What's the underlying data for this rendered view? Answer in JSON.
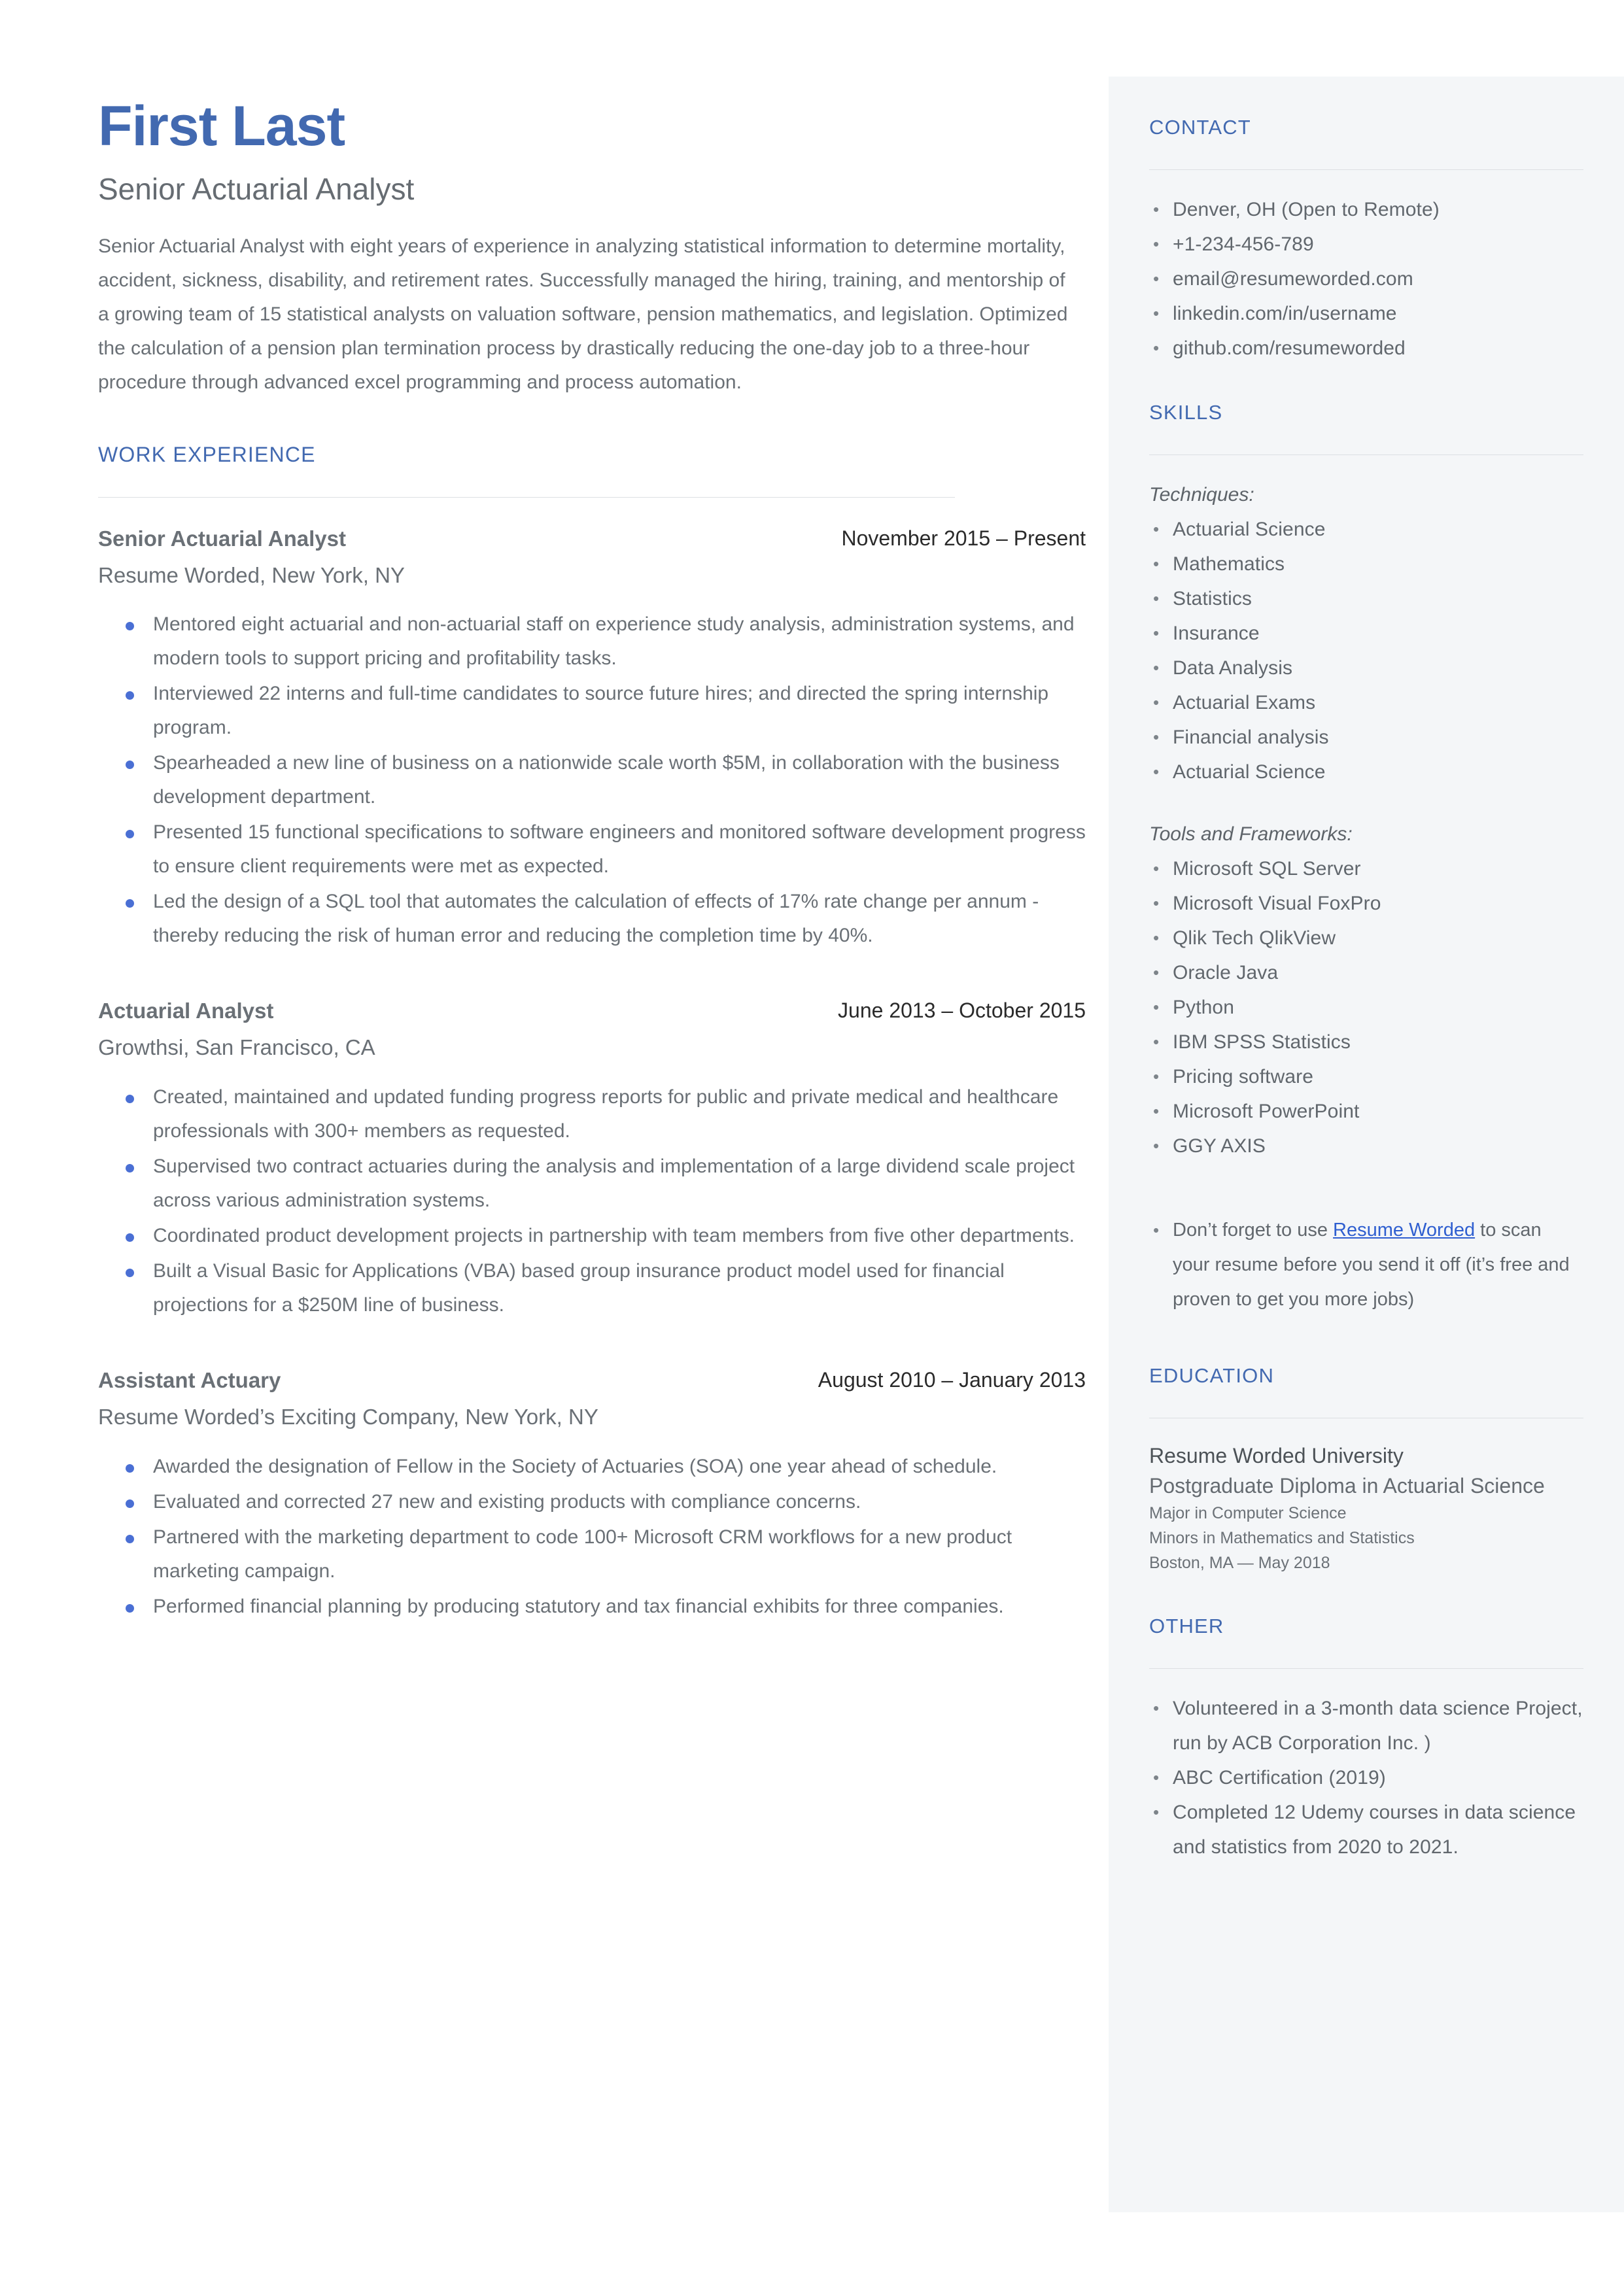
{
  "accent_color": "#4269b0",
  "bullet_color": "#4a6fd4",
  "sidebar_bg": "#f4f6f8",
  "header": {
    "name": "First Last",
    "role": "Senior Actuarial Analyst",
    "summary": "Senior Actuarial Analyst with eight years of experience in analyzing statistical information to determine mortality, accident, sickness, disability, and retirement rates. Successfully managed the hiring, training, and mentorship of a growing team of 15 statistical analysts on valuation software, pension mathematics, and legislation. Optimized the calculation of a pension plan termination process by drastically reducing the one-day job to a three-hour procedure through advanced excel programming and process automation."
  },
  "work": {
    "heading": "WORK EXPERIENCE",
    "jobs": [
      {
        "title": "Senior Actuarial Analyst",
        "dates": "November 2015 – Present",
        "company": "Resume Worded, New York, NY",
        "bullets": [
          "Mentored eight actuarial and non-actuarial staff on experience study analysis, administration systems, and modern tools to support pricing and profitability tasks.",
          "Interviewed 22 interns and full-time candidates to source future hires; and directed the spring internship program.",
          "Spearheaded a new line of business on a nationwide scale worth $5M, in collaboration with the business development department.",
          "Presented 15 functional specifications to software engineers and monitored software development progress to ensure client requirements were met as expected.",
          "Led the design of a SQL tool that automates the calculation of effects of 17% rate change per annum - thereby reducing the risk of human error and reducing the completion time by 40%."
        ]
      },
      {
        "title": "Actuarial Analyst",
        "dates": "June 2013 – October 2015",
        "company": "Growthsi, San Francisco, CA",
        "bullets": [
          "Created, maintained and updated funding progress reports for public and private medical and healthcare professionals with 300+ members as requested.",
          "Supervised two contract actuaries during the analysis and implementation of a large dividend scale project across various administration systems.",
          "Coordinated product development projects in partnership with team members from five other departments.",
          "Built a Visual Basic for Applications (VBA) based group insurance product model used for financial projections for a $250M line of business."
        ]
      },
      {
        "title": "Assistant Actuary",
        "dates": "August 2010 – January 2013",
        "company": "Resume Worded’s Exciting Company, New York, NY",
        "bullets": [
          "Awarded the designation of Fellow in the Society of Actuaries (SOA) one year ahead of schedule.",
          "Evaluated and corrected 27 new and existing products with compliance concerns.",
          "Partnered with the marketing department to code 100+ Microsoft CRM workflows for a new product marketing campaign.",
          "Performed financial planning by producing statutory and tax financial exhibits for three companies."
        ]
      }
    ]
  },
  "contact": {
    "heading": "CONTACT",
    "items": [
      "Denver, OH (Open to Remote)",
      "+1-234-456-789",
      "email@resumeworded.com",
      "linkedin.com/in/username",
      "github.com/resumeworded"
    ]
  },
  "skills": {
    "heading": "SKILLS",
    "techniques_label": "Techniques:",
    "techniques": [
      "Actuarial Science",
      "Mathematics",
      "Statistics",
      "Insurance",
      "Data Analysis",
      "Actuarial Exams",
      "Financial analysis",
      "Actuarial Science"
    ],
    "tools_label": "Tools and Frameworks:",
    "tools": [
      "Microsoft SQL Server",
      "Microsoft Visual FoxPro",
      "Qlik Tech QlikView",
      "Oracle Java",
      "Python",
      "IBM SPSS Statistics",
      "Pricing software",
      "Microsoft PowerPoint",
      "GGY AXIS"
    ]
  },
  "promo": {
    "before_link": "Don’t forget to use ",
    "link_text": "Resume Worded",
    "after_link": " to scan your resume before you send it off (it’s free and proven to get you more jobs)"
  },
  "education": {
    "heading": "EDUCATION",
    "school": "Resume Worded University",
    "degree": "Postgraduate Diploma in Actuarial Science",
    "major": "Major in Computer Science",
    "minors": "Minors in Mathematics and Statistics",
    "location_date": "Boston, MA — May 2018"
  },
  "other": {
    "heading": "OTHER",
    "items": [
      "Volunteered in a 3-month data science Project, run by ACB Corporation Inc. )",
      "ABC Certification (2019)",
      "Completed 12 Udemy courses in data science and statistics from 2020 to 2021."
    ]
  }
}
